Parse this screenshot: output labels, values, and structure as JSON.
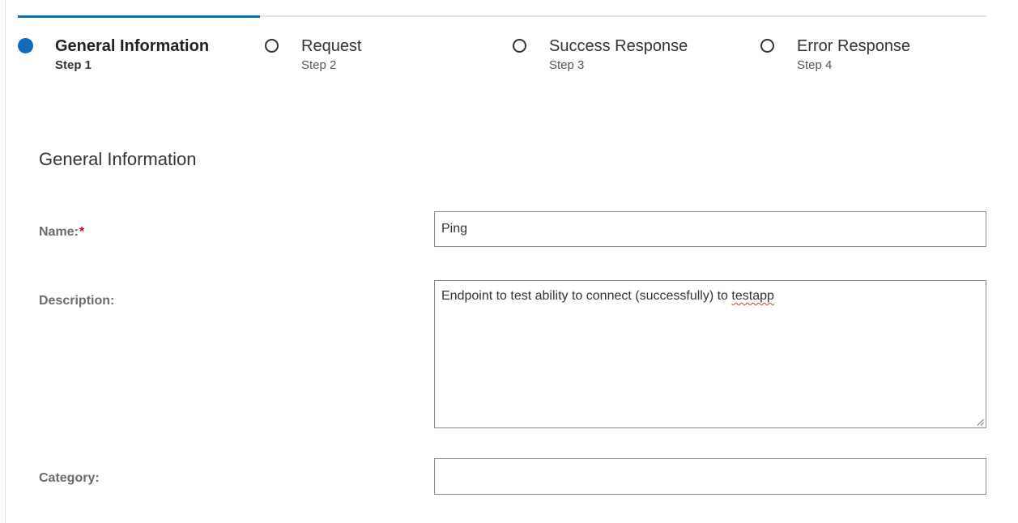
{
  "wizard": {
    "steps": [
      {
        "title": "General Information",
        "subtitle": "Step 1",
        "active": true
      },
      {
        "title": "Request",
        "subtitle": "Step 2",
        "active": false
      },
      {
        "title": "Success Response",
        "subtitle": "Step 3",
        "active": false
      },
      {
        "title": "Error Response",
        "subtitle": "Step 4",
        "active": false
      }
    ],
    "progress_fraction": 0.25
  },
  "form": {
    "section_title": "General Information",
    "name": {
      "label": "Name:",
      "required_marker": "*",
      "value": "Ping"
    },
    "description": {
      "label": "Description:",
      "value_prefix": "Endpoint to test ability to connect (successfully) to ",
      "value_flagged_word": "testapp"
    },
    "category": {
      "label": "Category:",
      "value": ""
    }
  },
  "colors": {
    "accent": "#0f6cbd",
    "required": "#d0021b",
    "spellcheck": "#e0382f"
  },
  "icons": {
    "active_step": "filled-circle-icon",
    "inactive_step": "empty-circle-icon",
    "resize": "resize-grip-icon"
  }
}
